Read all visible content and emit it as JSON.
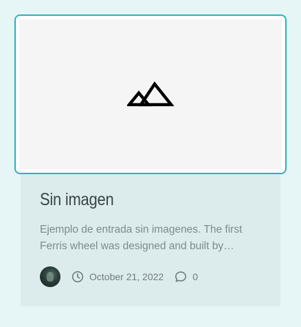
{
  "post": {
    "title": "Sin imagen",
    "excerpt": "Ejemplo de entrada sin imagenes. The first Ferris wheel was designed and built by…",
    "date": "October 21, 2022",
    "comment_count": "0"
  },
  "icons": {
    "thumbnail": "mountain-placeholder-icon",
    "date": "clock-icon",
    "comments": "comment-bubble-icon",
    "avatar": "author-avatar"
  },
  "colors": {
    "page_background": "#e6f5f6",
    "card_background": "#dcecec",
    "thumbnail_border": "#22b5bd",
    "title": "#3a4448",
    "excerpt": "#7d8a8f",
    "meta": "#6f7a7e"
  }
}
